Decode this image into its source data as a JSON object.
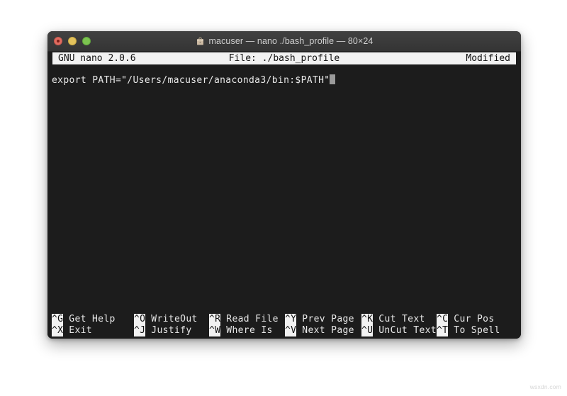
{
  "window": {
    "title": "macuser — nano ./bash_profile — 80×24",
    "folder_icon": "folder-icon",
    "traffic_lights": [
      {
        "name": "close-button",
        "color": "#e06c60"
      },
      {
        "name": "minimize-button",
        "color": "#e3c25c"
      },
      {
        "name": "maximize-button",
        "color": "#7cc450"
      }
    ]
  },
  "nano": {
    "version": "GNU nano 2.0.6",
    "file_label": "File: ./bash_profile",
    "status": "Modified",
    "editor": {
      "lines": [
        "export PATH=\"/Users/macuser/anaconda3/bin:$PATH\""
      ],
      "cursor": "block-cursor"
    },
    "shortcuts": [
      {
        "key": "^G",
        "label": "Get Help",
        "key2": "^X",
        "label2": "Exit"
      },
      {
        "key": "^O",
        "label": "WriteOut",
        "key2": "^J",
        "label2": "Justify"
      },
      {
        "key": "^R",
        "label": "Read File",
        "key2": "^W",
        "label2": "Where Is"
      },
      {
        "key": "^Y",
        "label": "Prev Page",
        "key2": "^V",
        "label2": "Next Page"
      },
      {
        "key": "^K",
        "label": "Cut Text",
        "key2": "^U",
        "label2": "UnCut Text"
      },
      {
        "key": "^C",
        "label": "Cur Pos",
        "key2": "^T",
        "label2": "To Spell"
      }
    ]
  },
  "colors": {
    "terminal_background": "#1c1c1c",
    "titlebar_background": "#3a3a3a",
    "inverted_background": "#f2f2f2",
    "text": "#e8e8e8",
    "page_background": "#ffffff"
  },
  "watermark": "wsxdn.com"
}
